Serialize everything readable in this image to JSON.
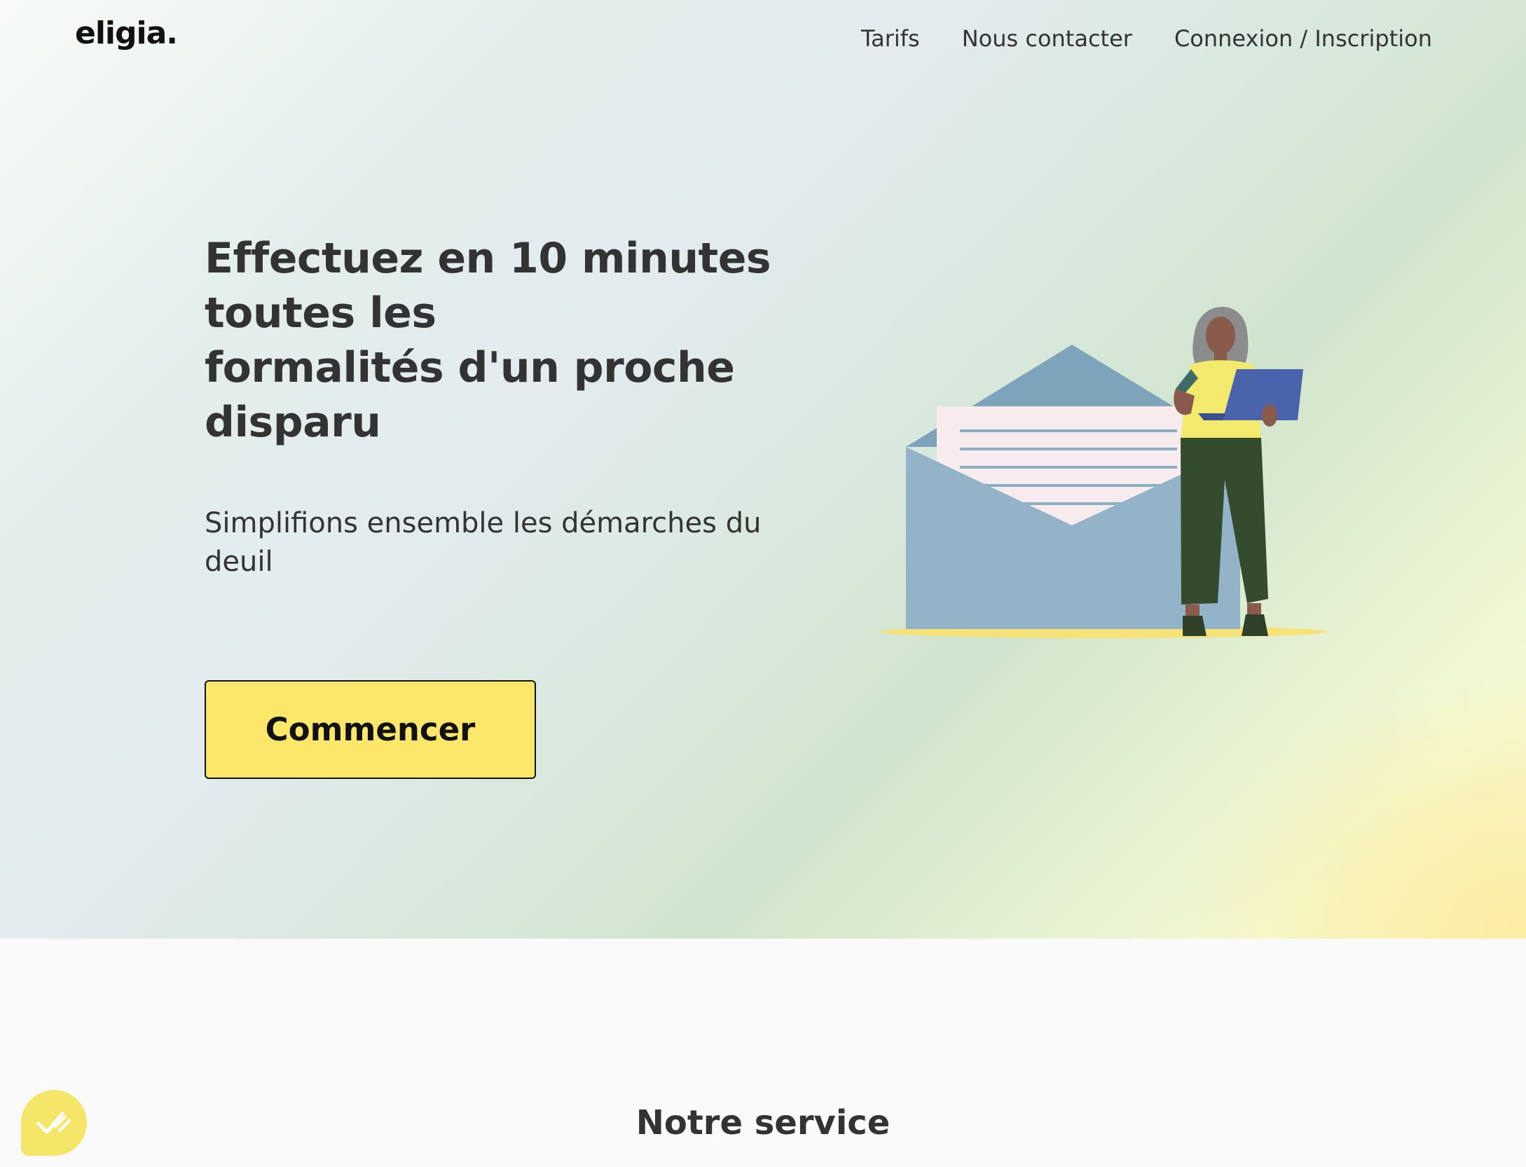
{
  "brand": {
    "logo": "eligia."
  },
  "nav": {
    "items": [
      "Tarifs",
      "Nous contacter",
      "Connexion / Inscription"
    ]
  },
  "hero": {
    "headline_lines": [
      "Effectuez en 10 minutes",
      "toutes les",
      "formalités d'un proche",
      "disparu"
    ],
    "subtitle": "Simplifions ensemble les démarches du deuil",
    "cta_label": "Commencer"
  },
  "service": {
    "title": "Notre service"
  },
  "colors": {
    "accent": "#fce76a",
    "text": "#333333",
    "envelope": "#92b3c8",
    "laptop": "#4a63ad",
    "pants": "#354b2e"
  },
  "icons": {
    "badge": "check-icon",
    "hero_illustration": "woman-with-laptop-and-envelope"
  }
}
